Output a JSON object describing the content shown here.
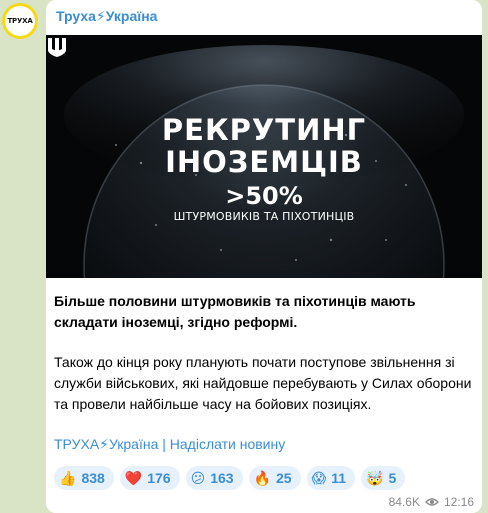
{
  "channel": {
    "name": "Труха⚡Україна",
    "avatar_text": "ТРУХА",
    "avatar_color": "#f5d916"
  },
  "image": {
    "line1": "РЕКРУТИНГ",
    "line2": "ІНОЗЕМЦІВ",
    "stat": ">50%",
    "stat_caption": "ШТУРМОВИКІВ ТА ПІХОТИНЦІВ",
    "emblem_icon": "trident-icon"
  },
  "message": {
    "bold_paragraph": "Більше половини штурмовиків та піхотинців мають складати іноземці, згідно реформі.",
    "paragraph": "Також до кінця року планують почати поступове звільнення зі служби військових, які найдовше перебувають у Силах оборони та провели найбільше часу на бойових позиціях.",
    "link_channel": "ТРУХА⚡Україна",
    "link_separator": " | ",
    "link_submit": "Надіслати новину"
  },
  "reactions": [
    {
      "emoji": "👍",
      "count": "838"
    },
    {
      "emoji": "❤️",
      "count": "176"
    },
    {
      "emoji": "😕",
      "count": "163"
    },
    {
      "emoji": "🔥",
      "count": "25"
    },
    {
      "emoji": "😱",
      "count": "11"
    },
    {
      "emoji": "🤯",
      "count": "5"
    }
  ],
  "meta": {
    "views": "84.6K",
    "time": "12:16",
    "views_icon": "eye-icon"
  },
  "colors": {
    "accent": "#3a8ed1",
    "background": "#d9e4c6",
    "reaction_bg": "#e7f1fb"
  }
}
